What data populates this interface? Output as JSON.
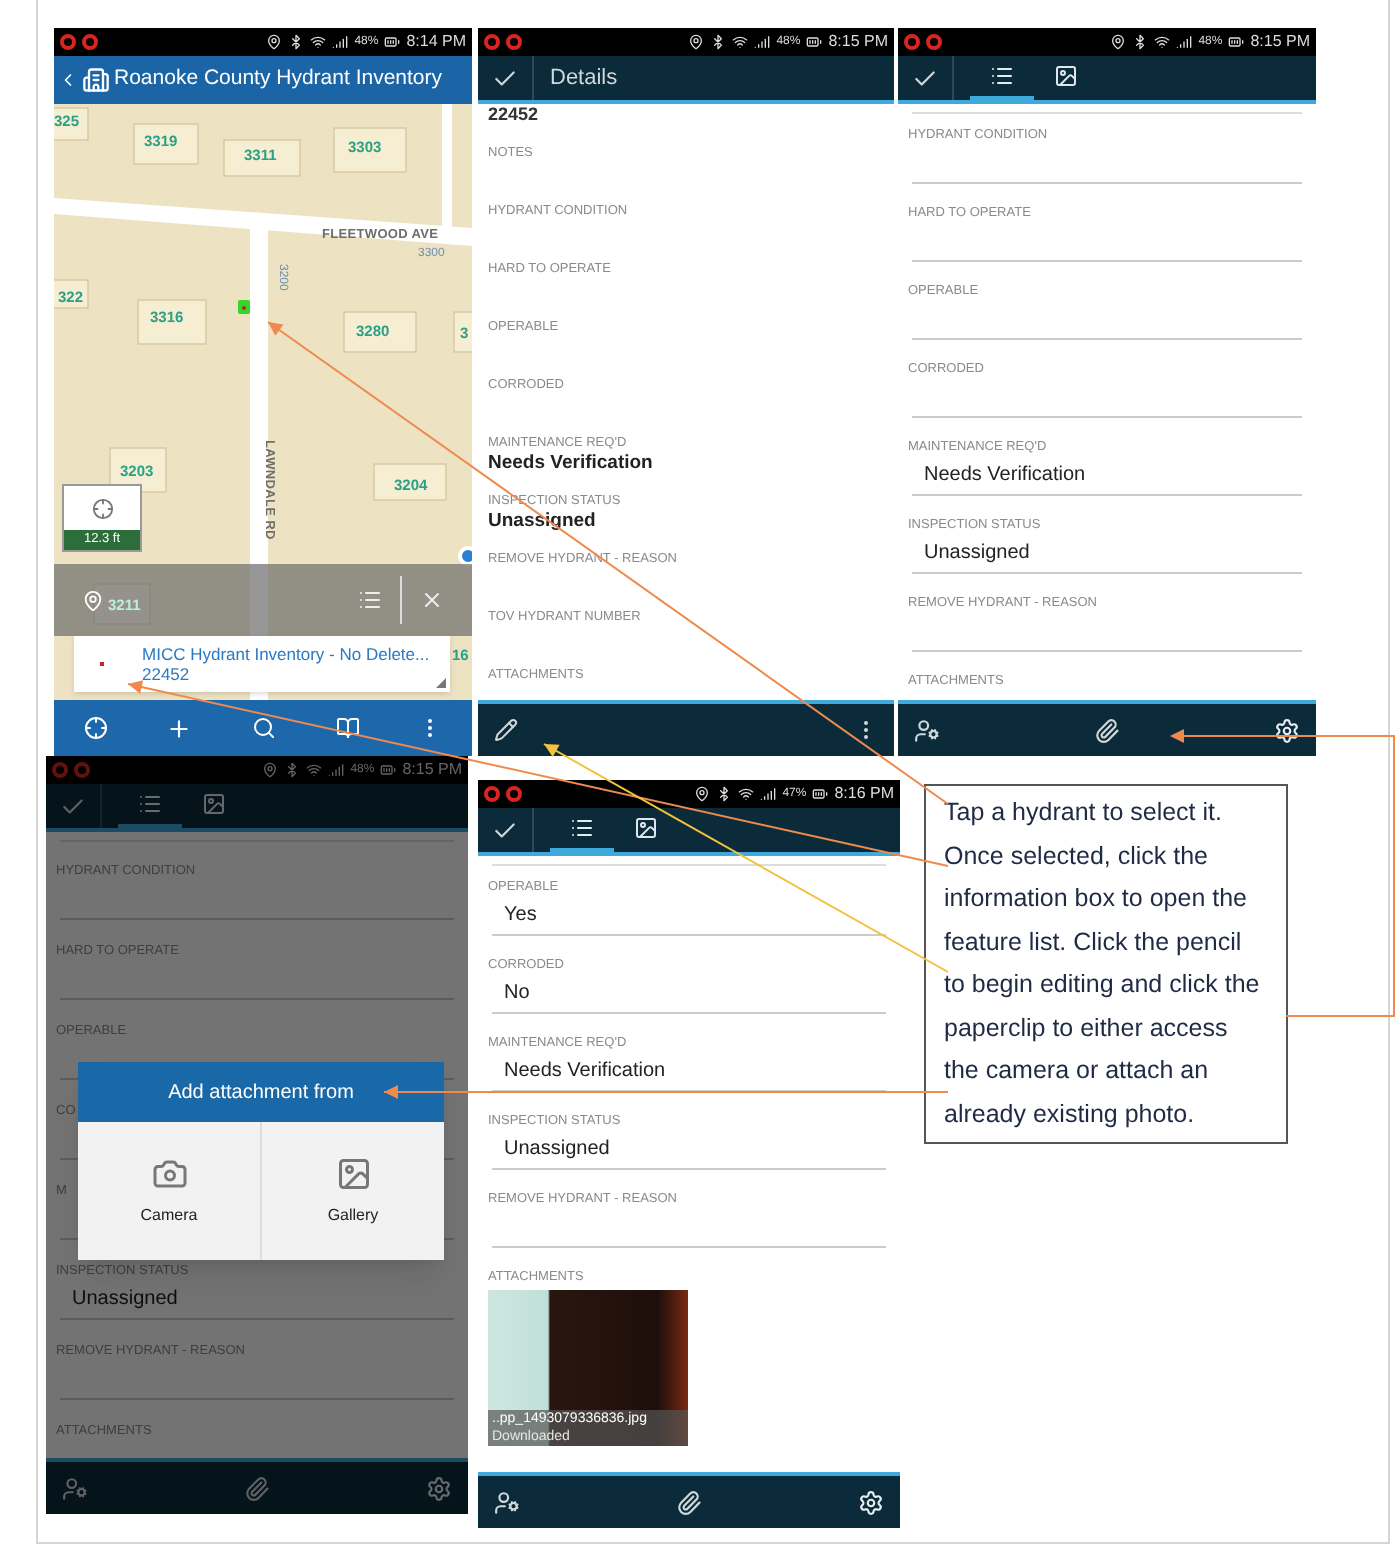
{
  "screens": [
    {
      "kind": "map",
      "status": {
        "battery": "48%",
        "time": "8:14 PM"
      },
      "title": "Roanoke County Hydrant Inventory",
      "map_labels": [
        "325",
        "3319",
        "3311",
        "3303",
        "FLEETWOOD AVE",
        "3300",
        "322",
        "3316",
        "3200",
        "3280",
        "3",
        "LAWNDALE RD",
        "3203",
        "3204",
        "3211",
        "16"
      ],
      "scale": "12.3 ft",
      "popup": {
        "title": "MICC Hydrant Inventory - No Delete...",
        "subtitle": "22452"
      }
    },
    {
      "kind": "details",
      "status": {
        "battery": "48%",
        "time": "8:15 PM"
      },
      "title": "Details",
      "record": "22452",
      "fields": [
        {
          "label": "NOTES"
        },
        {
          "label": "HYDRANT CONDITION"
        },
        {
          "label": "HARD TO OPERATE"
        },
        {
          "label": "OPERABLE"
        },
        {
          "label": "CORRODED"
        },
        {
          "label": "MAINTENANCE REQ'D",
          "value": "Needs Verification"
        },
        {
          "label": "INSPECTION STATUS",
          "value": "Unassigned"
        },
        {
          "label": "REMOVE HYDRANT - REASON"
        },
        {
          "label": "TOV HYDRANT NUMBER"
        },
        {
          "label": "ATTACHMENTS"
        }
      ]
    },
    {
      "kind": "form",
      "status": {
        "battery": "48%",
        "time": "8:15 PM"
      },
      "tabs": [
        {
          "selected": true
        },
        {
          "selected": false
        }
      ],
      "fields": [
        {
          "label": "HYDRANT CONDITION"
        },
        {
          "label": "HARD TO OPERATE"
        },
        {
          "label": "OPERABLE"
        },
        {
          "label": "CORRODED"
        },
        {
          "label": "MAINTENANCE REQ'D",
          "value": "Needs Verification"
        },
        {
          "label": "INSPECTION STATUS",
          "value": "Unassigned"
        },
        {
          "label": "REMOVE HYDRANT - REASON"
        }
      ],
      "attachments_label": "ATTACHMENTS"
    },
    {
      "kind": "form",
      "status": {
        "battery": "48%",
        "time": "8:15 PM"
      },
      "tabs": [
        {
          "selected": true
        },
        {
          "selected": false
        }
      ],
      "fields": [
        {
          "label": "HYDRANT CONDITION"
        },
        {
          "label": "HARD TO OPERATE"
        },
        {
          "label": "OPERABLE"
        },
        {
          "label": "CO"
        },
        {
          "label": "M"
        },
        {
          "label": "INSPECTION STATUS",
          "value": "Unassigned"
        },
        {
          "label": "REMOVE HYDRANT - REASON"
        }
      ],
      "attachments_label": "ATTACHMENTS",
      "dialog": {
        "title": "Add attachment from",
        "options": [
          {
            "kind": "camera",
            "label": "Camera"
          },
          {
            "kind": "gallery",
            "label": "Gallery"
          }
        ]
      }
    },
    {
      "kind": "form",
      "status": {
        "battery": "47%",
        "time": "8:16 PM"
      },
      "tabs": [
        {
          "selected": true
        },
        {
          "selected": false
        }
      ],
      "fields": [
        {
          "label": "OPERABLE",
          "value": "Yes"
        },
        {
          "label": "CORRODED",
          "value": "No"
        },
        {
          "label": "MAINTENANCE REQ'D",
          "value": "Needs Verification"
        },
        {
          "label": "INSPECTION STATUS",
          "value": "Unassigned"
        },
        {
          "label": "REMOVE HYDRANT - REASON"
        }
      ],
      "attachments_label": "ATTACHMENTS",
      "attachment": {
        "filename": "..pp_1493079336836.jpg",
        "status": "Downloaded"
      }
    }
  ],
  "callout": {
    "text": "Tap a hydrant to select it. Once selected, click the information box to open the feature list. Click the pencil to begin editing and click the paperclip to either access the camera or attach an already existing photo."
  }
}
